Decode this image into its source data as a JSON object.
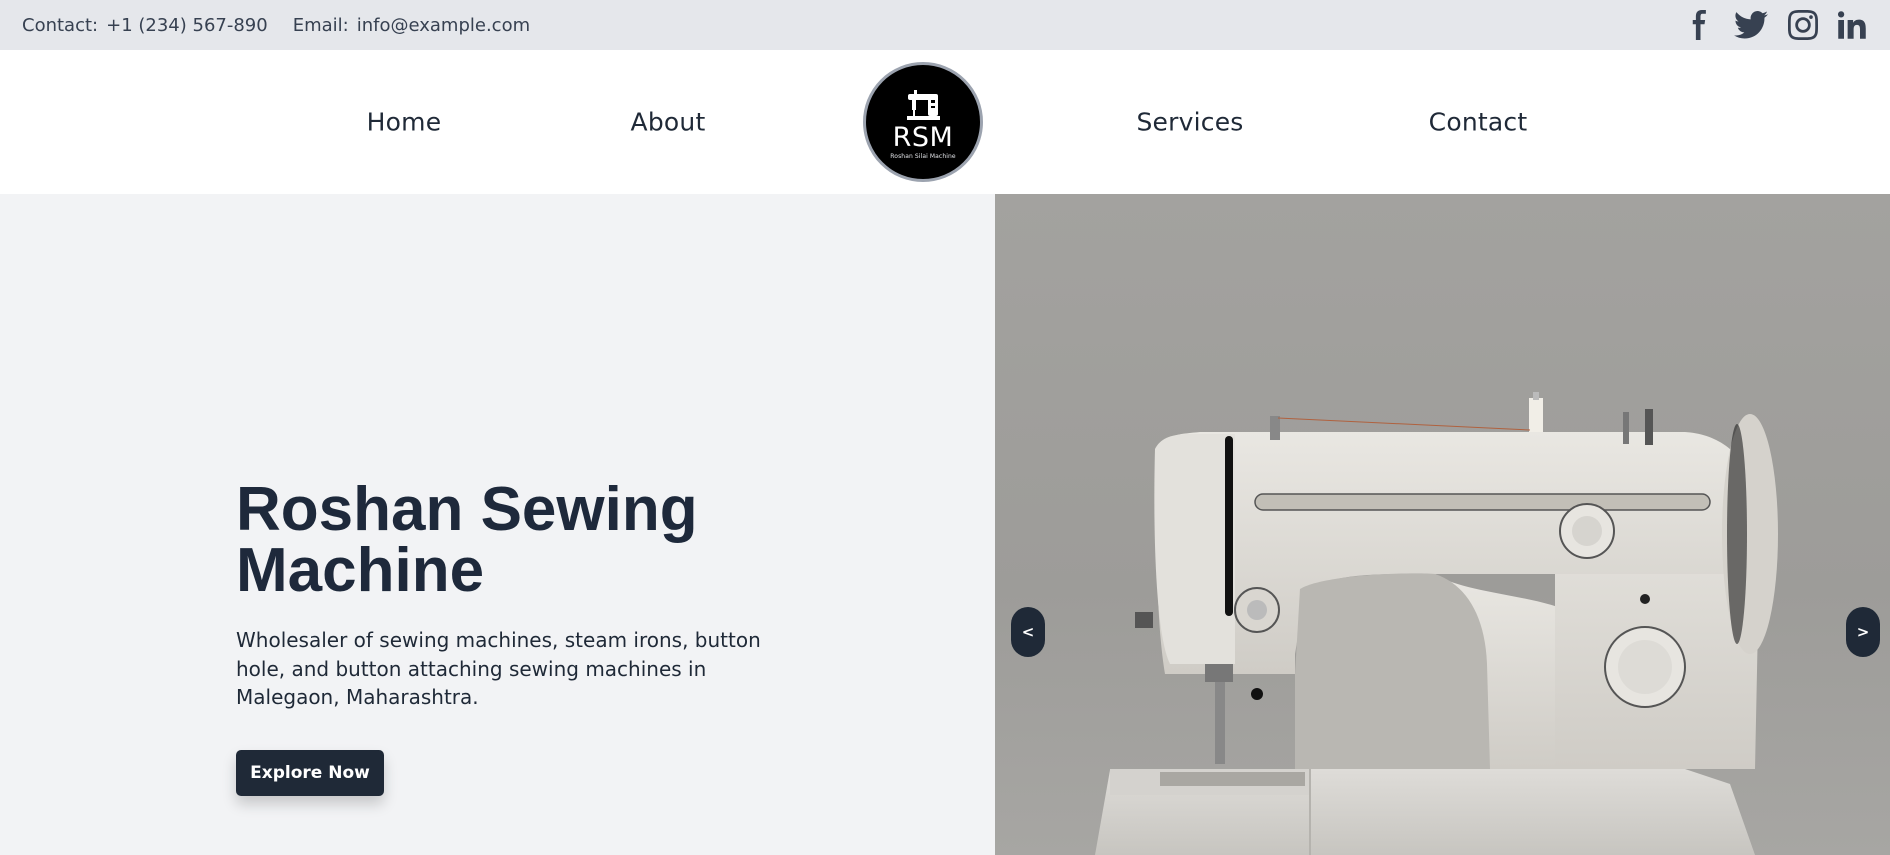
{
  "topbar": {
    "contact_label": "Contact:",
    "contact_value": "+1 (234) 567-890",
    "email_label": "Email:",
    "email_value": "info@example.com",
    "socials": [
      {
        "icon": "facebook-icon"
      },
      {
        "icon": "twitter-icon"
      },
      {
        "icon": "instagram-icon"
      },
      {
        "icon": "linkedin-icon"
      }
    ]
  },
  "nav": {
    "items": [
      "Home",
      "About",
      "Services",
      "Contact"
    ],
    "logo": {
      "text": "RSM",
      "subtext": "Roshan Silai Machine"
    }
  },
  "hero": {
    "title_line1": "Roshan Sewing",
    "title_line2": "Machine",
    "description": "Wholesaler of sewing machines, steam irons, button hole, and button attaching sewing machines in Malegaon, Maharashtra.",
    "cta_label": "Explore Now",
    "image_alt": "sewing-machine-photo",
    "prev_label": "<",
    "next_label": ">"
  },
  "colors": {
    "topbar_bg": "#e5e7eb",
    "accent_dark": "#1f2937",
    "hero_bg": "#f2f3f5"
  }
}
